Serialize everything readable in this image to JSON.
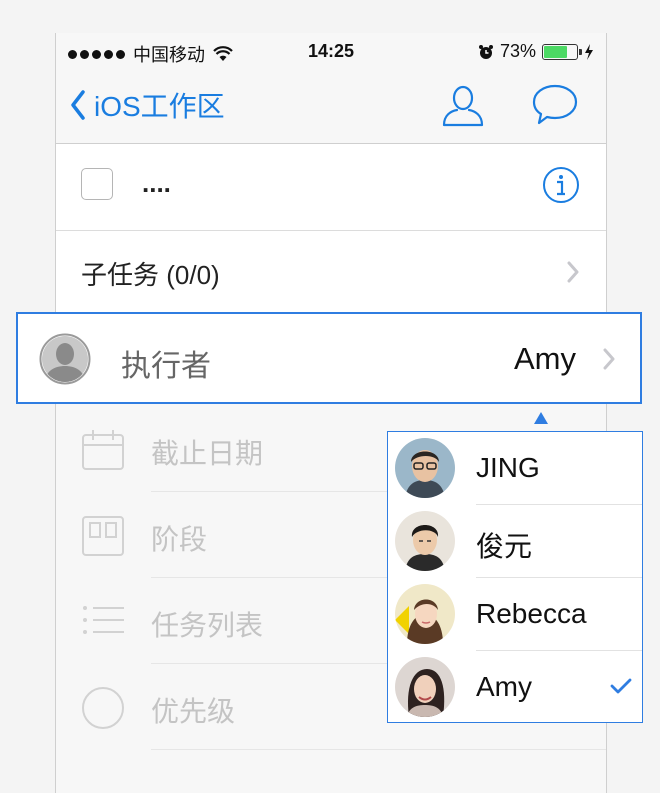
{
  "status_bar": {
    "carrier": "中国移动",
    "time": "14:25",
    "battery_percent": "73%",
    "battery_level": 0.73
  },
  "nav": {
    "back_label": "iOS工作区",
    "accent": "#1a7de0"
  },
  "task": {
    "title": "...."
  },
  "subtask": {
    "label": "子任务 (0/0)"
  },
  "assignee": {
    "label": "执行者",
    "value": "Amy",
    "highlight": "#2f7de1"
  },
  "dimmed_rows": [
    {
      "label": "截止日期",
      "icon": "calendar-icon"
    },
    {
      "label": "阶段",
      "icon": "stage-columns-icon"
    },
    {
      "label": "任务列表",
      "icon": "list-icon"
    },
    {
      "label": "优先级",
      "icon": "priority-circle-icon"
    }
  ],
  "members": [
    {
      "name": "JING",
      "selected": false
    },
    {
      "name": "俊元",
      "selected": false
    },
    {
      "name": "Rebecca",
      "selected": false
    },
    {
      "name": "Amy",
      "selected": true
    }
  ]
}
